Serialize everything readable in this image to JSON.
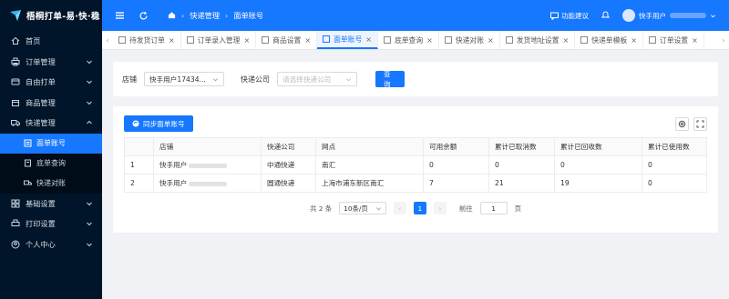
{
  "app": {
    "title": "梧桐打单-易·快·稳"
  },
  "sidebar": {
    "items": [
      {
        "label": "首页",
        "icon": "home-icon",
        "chevron": false
      },
      {
        "label": "订单管理",
        "icon": "printer-icon",
        "chevron": true
      },
      {
        "label": "自由打单",
        "icon": "card-icon",
        "chevron": true
      },
      {
        "label": "商品管理",
        "icon": "box-icon",
        "chevron": true
      },
      {
        "label": "快递管理",
        "icon": "truck-icon",
        "chevron": true,
        "expanded": true
      }
    ],
    "sub_items": [
      {
        "label": "面单账号",
        "active": true
      },
      {
        "label": "底单查询",
        "active": false
      },
      {
        "label": "快递对账",
        "active": false
      }
    ],
    "items_after": [
      {
        "label": "基础设置",
        "icon": "grid-icon"
      },
      {
        "label": "打印设置",
        "icon": "printer-icon"
      },
      {
        "label": "个人中心",
        "icon": "user-icon"
      }
    ]
  },
  "header": {
    "breadcrumb": [
      "快递管理",
      "面单账号"
    ],
    "feedback": "功能建议",
    "user": "快手用户"
  },
  "tabs": [
    {
      "label": "待发货订单",
      "active": false
    },
    {
      "label": "订单录入管理",
      "active": false
    },
    {
      "label": "商品设置",
      "active": false
    },
    {
      "label": "面单账号",
      "active": true
    },
    {
      "label": "底单查询",
      "active": false
    },
    {
      "label": "快递对账",
      "active": false
    },
    {
      "label": "发货地址设置",
      "active": false
    },
    {
      "label": "快递单模板",
      "active": false
    },
    {
      "label": "订单设置",
      "active": false
    }
  ],
  "filter": {
    "store_label": "店铺",
    "store_value": "快手用户17434...",
    "express_label": "快递公司",
    "express_placeholder": "请选择快递公司",
    "query_button": "查询"
  },
  "table": {
    "sync_button": "同步面单账号",
    "columns": [
      "",
      "店铺",
      "快递公司",
      "网点",
      "可用余额",
      "累计已取消数",
      "累计已回收数",
      "累计已使用数"
    ],
    "rows": [
      {
        "index": "1",
        "store": "快手用户",
        "express": "中通快递",
        "outlet": "南汇",
        "balance": "0",
        "cancelled": "0",
        "recycled": "0",
        "used": "0"
      },
      {
        "index": "2",
        "store": "快手用户",
        "express": "圆通快递",
        "outlet": "上海市浦东新区南汇",
        "balance": "7",
        "cancelled": "21",
        "recycled": "19",
        "used": "0"
      }
    ]
  },
  "pager": {
    "total": "共 2 条",
    "page_size": "10条/页",
    "current": "1",
    "goto_label": "前往",
    "goto_value": "1",
    "page_unit": "页"
  },
  "colors": {
    "primary": "#1677ff",
    "sidebar_bg": "#001529"
  }
}
